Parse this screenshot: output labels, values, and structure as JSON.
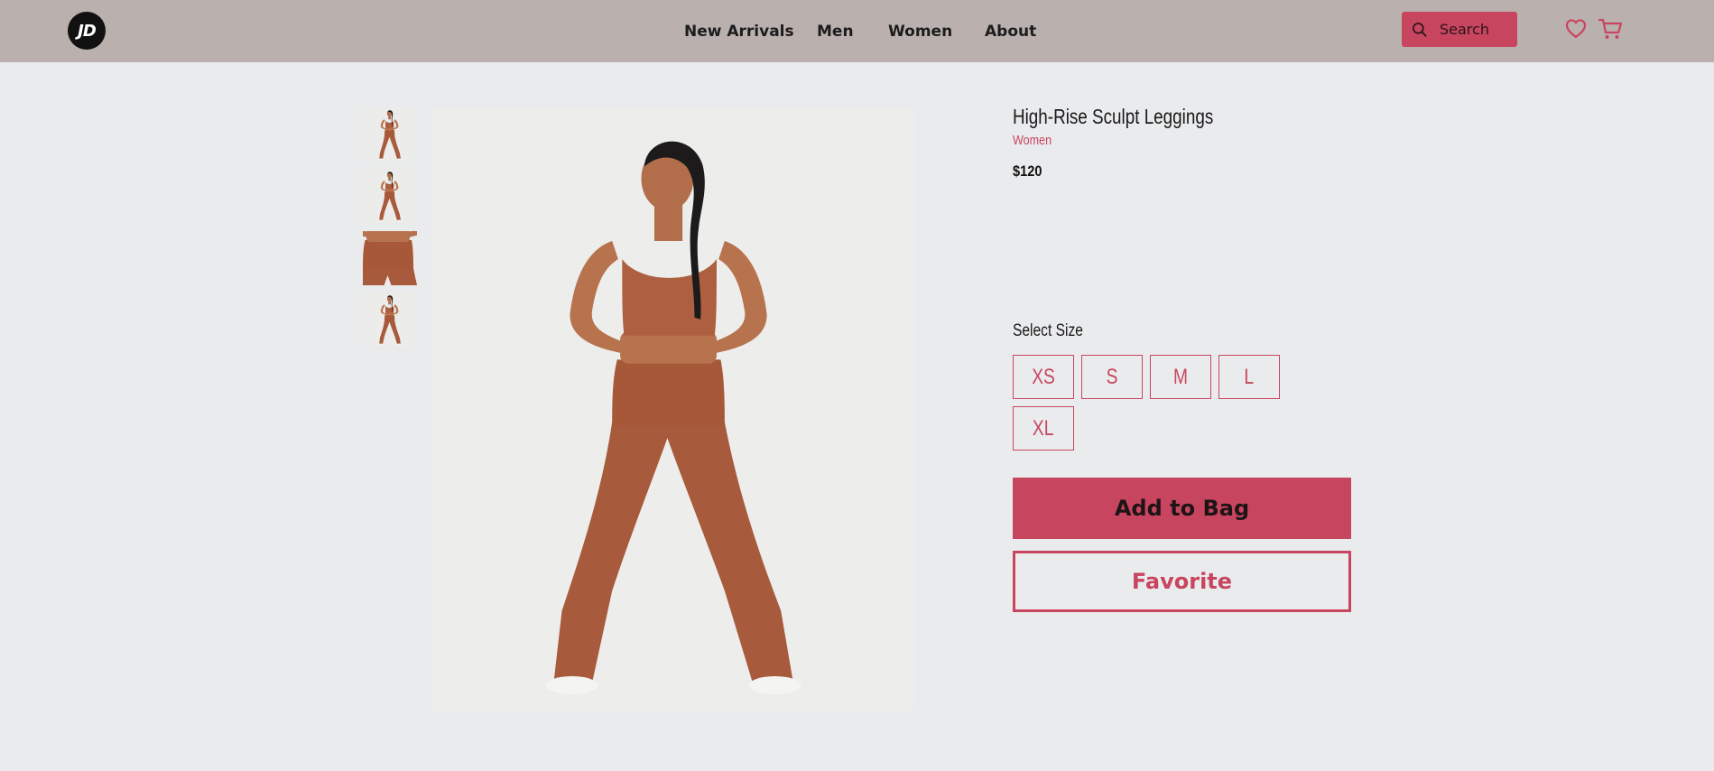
{
  "header": {
    "logo_text": "JD",
    "nav": [
      "New Arrivals",
      "Men",
      "Women",
      "About"
    ],
    "search_placeholder": "Search"
  },
  "icons": {
    "logo": "jd-logo",
    "search": "search-icon",
    "favorites": "heart-icon",
    "cart": "cart-icon"
  },
  "product": {
    "title": "High-Rise Sculpt Leggings",
    "category": "Women",
    "price": "$120",
    "size_label": "Select Size",
    "sizes": [
      "XS",
      "S",
      "M",
      "L",
      "XL"
    ],
    "add_to_bag": "Add to Bag",
    "favorite": "Favorite"
  },
  "colors": {
    "header_bg": "#bab1ae",
    "page_bg": "#eaebed",
    "accent": "#c8455f",
    "garment": "#a85a3c"
  }
}
